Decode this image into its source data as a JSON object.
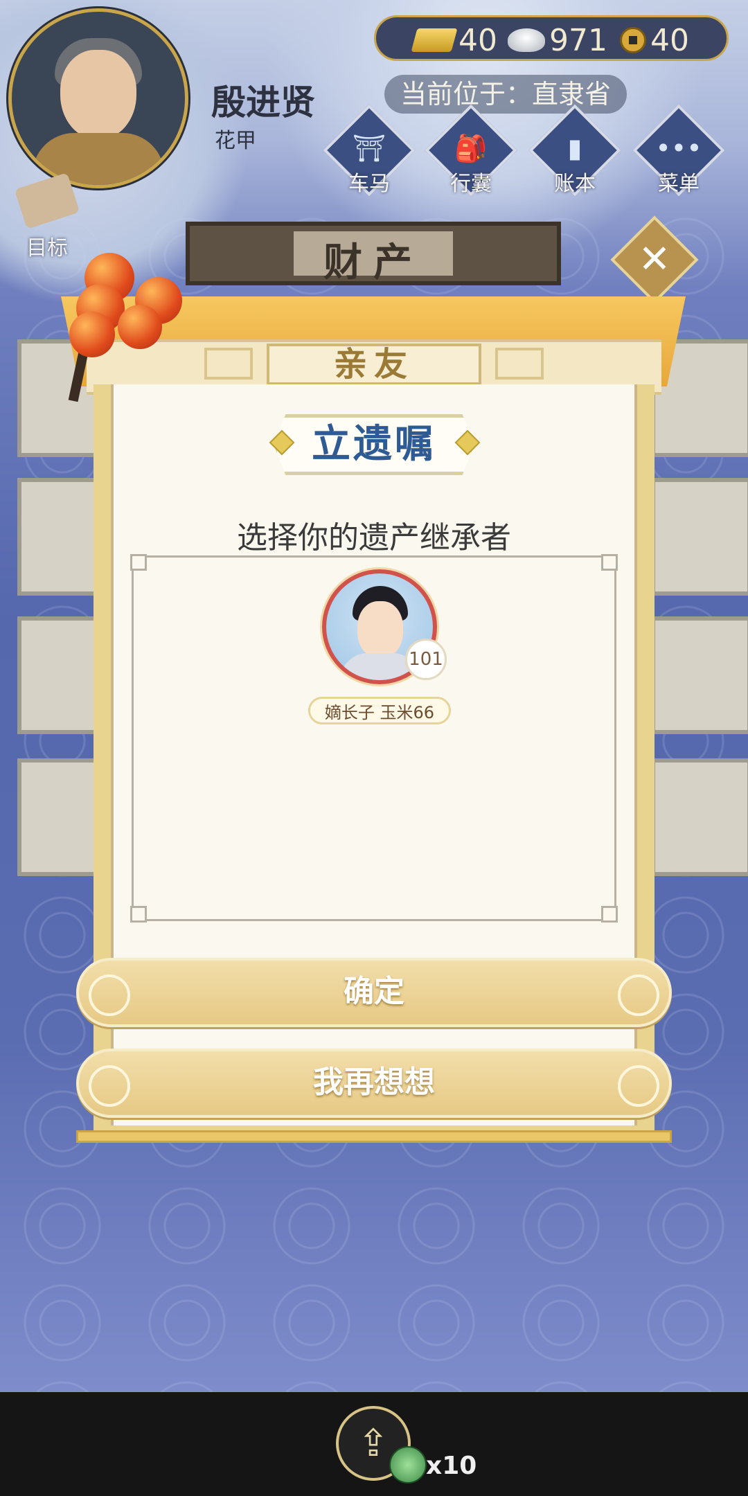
{
  "player": {
    "name": "殷进贤",
    "title": "花甲"
  },
  "currency": {
    "gold": "40",
    "silver": "971",
    "coin": "40"
  },
  "location": "当前位于：直隶省",
  "menu": [
    {
      "label": "车马",
      "icon": "carriage-icon"
    },
    {
      "label": "行囊",
      "icon": "bag-icon"
    },
    {
      "label": "账本",
      "icon": "ledger-icon"
    },
    {
      "label": "菜单",
      "icon": "menu-dots-icon"
    }
  ],
  "goal_label": "目标",
  "panel_header": "财产",
  "tab": "亲友",
  "dialog": {
    "title": "立遗嘱",
    "prompt": "选择你的遗产继承者",
    "heir": {
      "age": "101",
      "name": "嫡长子 玉米66"
    },
    "confirm_label": "确定",
    "cancel_label": "我再想想"
  },
  "share": {
    "multiplier": "x10"
  },
  "colors": {
    "accent_gold": "#e8c96f",
    "title_blue": "#2f5b95",
    "background": "#5a6cb0"
  }
}
